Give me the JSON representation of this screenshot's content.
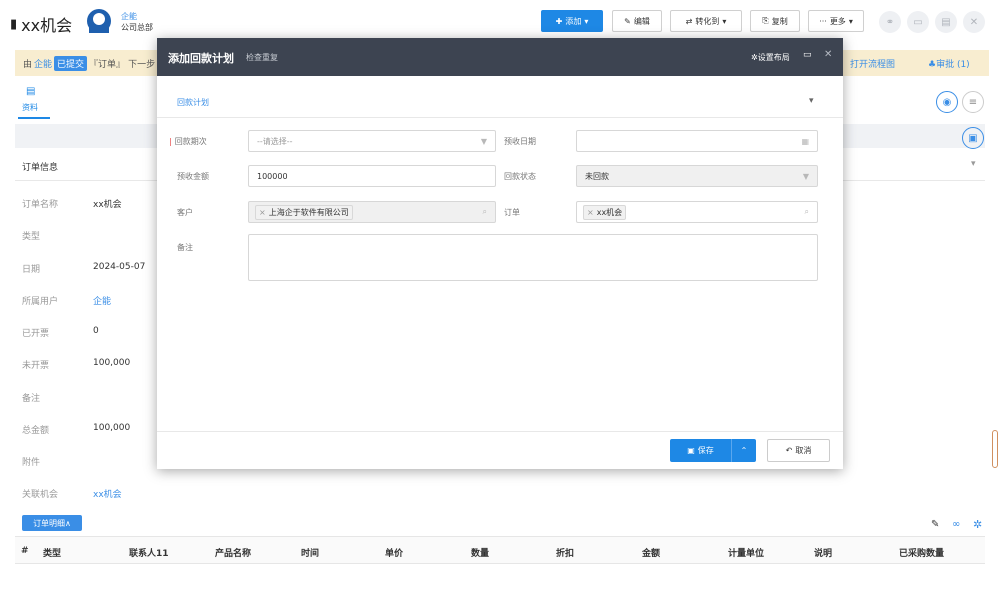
{
  "header": {
    "title": "xx机会",
    "user_name": "企能",
    "user_org": "公司总部",
    "add_label": "添加",
    "edit_label": "编辑",
    "convert_label": "转化到",
    "copy_label": "复制",
    "more_label": "更多"
  },
  "notice": {
    "prefix": "由",
    "user": "企能",
    "status": "已提交",
    "doc": "『订单』",
    "next": "下一步",
    "flow_link": "打开流程图",
    "approve": "审批 (1)"
  },
  "tab": {
    "label": "资料"
  },
  "section": {
    "title": "订单信息"
  },
  "fields": [
    {
      "label": "订单名称",
      "value": "xx机会",
      "link": false
    },
    {
      "label": "类型",
      "value": "",
      "link": false
    },
    {
      "label": "日期",
      "value": "2024-05-07",
      "link": false
    },
    {
      "label": "所属用户",
      "value": "企能",
      "link": true
    },
    {
      "label": "已开票",
      "value": "0",
      "link": false
    },
    {
      "label": "未开票",
      "value": "100,000",
      "link": false
    },
    {
      "label": "备注",
      "value": "",
      "link": false
    },
    {
      "label": "总金额",
      "value": "100,000",
      "link": false
    },
    {
      "label": "附件",
      "value": "",
      "link": false
    },
    {
      "label": "关联机会",
      "value": "xx机会",
      "link": true
    }
  ],
  "subgrid": {
    "button": "订单明细∧",
    "columns": [
      "#",
      "类型",
      "联系人11",
      "产品名称",
      "时间",
      "单价",
      "数量",
      "折扣",
      "金额",
      "计量单位",
      "说明",
      "已采购数量"
    ]
  },
  "modal": {
    "title": "添加回款计划",
    "subtitle": "检查重复",
    "layout_label": "设置布局",
    "section": "回款计划",
    "period_label": "回款期次",
    "period_placeholder": "--请选择--",
    "date_label": "预收日期",
    "amount_label": "预收金额",
    "amount_value": "100000",
    "status_label": "回款状态",
    "status_value": "未回款",
    "customer_label": "客户",
    "customer_value": "上海企于软件有限公司",
    "order_label": "订单",
    "order_value": "xx机会",
    "remark_label": "备注",
    "save_label": "保存",
    "cancel_label": "取消"
  }
}
